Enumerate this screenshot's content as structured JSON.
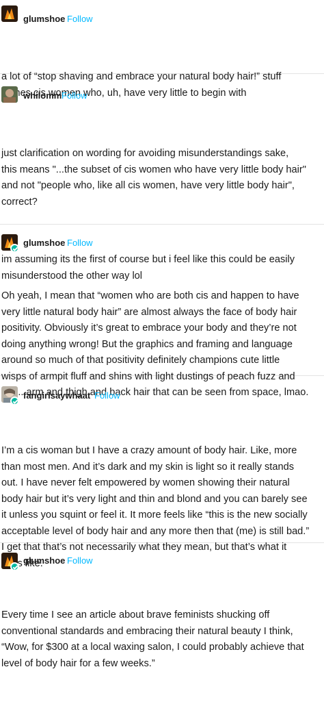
{
  "thread": {
    "follow_label": "Follow",
    "posts": [
      {
        "username": "glumshoe",
        "paragraphs": [
          "a lot of “stop shaving and embrace your natural body hair!” stuff\ncomes cis women who, uh, have very little to begin with"
        ]
      },
      {
        "username": "whilomm",
        "paragraphs": [
          "just clarification on wording for avoiding misunderstandings sake,\nthis means \"...the subset of cis women who have very little body hair\"\nand not \"people who, like all cis women, have very little body hair\",\ncorrect?",
          "im assuming its the first of course but i feel like this could be easily\nmisunderstood the other way lol"
        ]
      },
      {
        "username": "glumshoe",
        "paragraphs": [
          "Oh yeah, I mean that “women who are both cis and happen to have\nvery little natural body hair” are almost always the face of body hair\npositivity. Obviously it’s great to embrace your body and they’re not\ndoing anything wrong! But the graphics and framing and language\naround so much of that positivity definitely champions cute little\nwisps of armpit fluff and shins with light dustings of peach fuzz and\nnot... arm and thigh and back hair that can be seen from space, lmao."
        ]
      },
      {
        "username": "fangirlsaywhaat",
        "paragraphs": [
          "I’m a cis woman but I have a crazy amount of body hair. Like, more\nthan most men. And it’s dark and my skin is light so it really stands\nout. I have never felt empowered by women showing their natural\nbody hair but it’s very light and thin and blond and you can barely see\nit unless you squint or feel it. It more feels like “this is the new socially\nacceptable level of body hair and any more then that (me) is still bad.”\nI get that that’s not necessarily what they mean, but that’s what it\nfeels like."
        ]
      },
      {
        "username": "glumshoe",
        "paragraphs": [
          "Every time I see an article about brave feminists shucking off\nconventional standards and embracing their natural beauty I think,\n“Wow, for $300 at a local waxing salon, I could probably achieve that\nlevel of body hair for a few weeks.”"
        ]
      }
    ]
  },
  "colors": {
    "follow": "#00b8ff",
    "badge": "#00b8a0",
    "divider": "#e3e3e3",
    "text": "#1a1a1a"
  },
  "icons": {
    "glumshoe_avatar": "orange-flame-avatar",
    "whilomm_avatar": "photo-avatar",
    "fangirlsaywhaat_avatar": "photo-avatar",
    "badge": "green-check-badge"
  }
}
